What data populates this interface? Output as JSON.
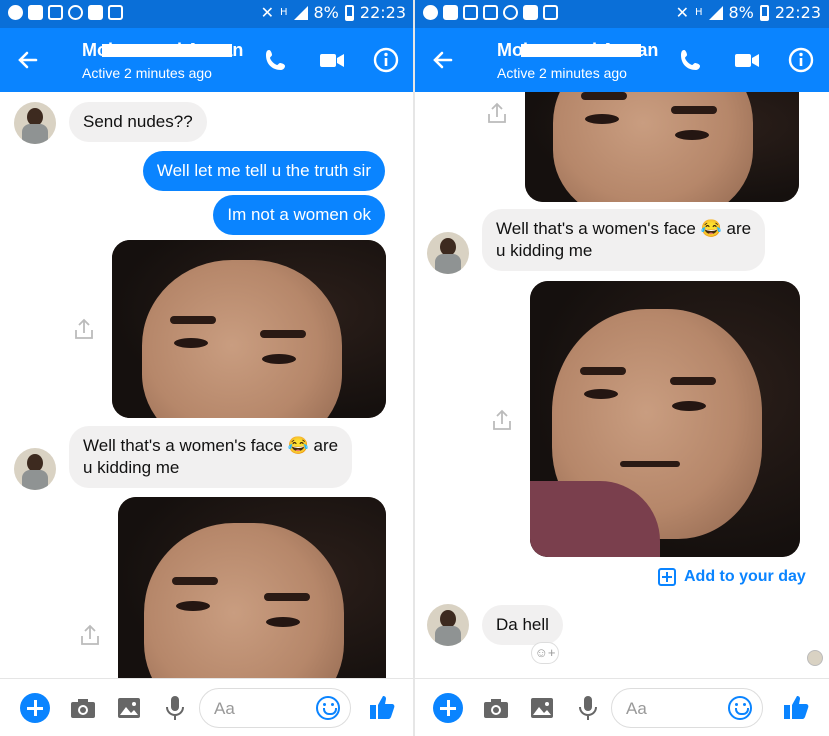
{
  "status_bar": {
    "battery": "8%",
    "time": "22:23",
    "network": "H"
  },
  "left": {
    "header": {
      "name": "Mohammad Arman",
      "status": "Active 2 minutes ago"
    },
    "messages": [
      {
        "type": "text",
        "dir": "in",
        "text": "Send nudes??"
      },
      {
        "type": "text",
        "dir": "out",
        "text": "Well let me tell u the truth sir"
      },
      {
        "type": "text",
        "dir": "out",
        "text": "Im not a women ok"
      },
      {
        "type": "photo",
        "dir": "out"
      },
      {
        "type": "text",
        "dir": "in",
        "text_line1": "Well that's a women's face 😂 are",
        "text_line2": "u kidding me"
      },
      {
        "type": "photo",
        "dir": "out"
      }
    ],
    "composer": {
      "placeholder": "Aa"
    }
  },
  "right": {
    "header": {
      "name": "Mohammad Arman",
      "status": "Active 2 minutes ago"
    },
    "messages": [
      {
        "type": "photo",
        "dir": "out"
      },
      {
        "type": "text",
        "dir": "in",
        "text_line1": "Well that's a women's face 😂 are",
        "text_line2": "u kidding me"
      },
      {
        "type": "photo",
        "dir": "out"
      },
      {
        "type": "action",
        "text": "Add to your day"
      },
      {
        "type": "text",
        "dir": "in",
        "text": "Da hell"
      }
    ],
    "composer": {
      "placeholder": "Aa"
    }
  },
  "colors": {
    "brand_blue": "#0a84ff",
    "status_blue": "#0a6fd8",
    "incoming_bubble": "#f1f0f0"
  },
  "icons": [
    "back-arrow-icon",
    "phone-icon",
    "video-icon",
    "info-icon",
    "share-icon",
    "plus-icon",
    "camera-icon",
    "image-icon",
    "microphone-icon",
    "emoji-icon",
    "like-icon"
  ]
}
